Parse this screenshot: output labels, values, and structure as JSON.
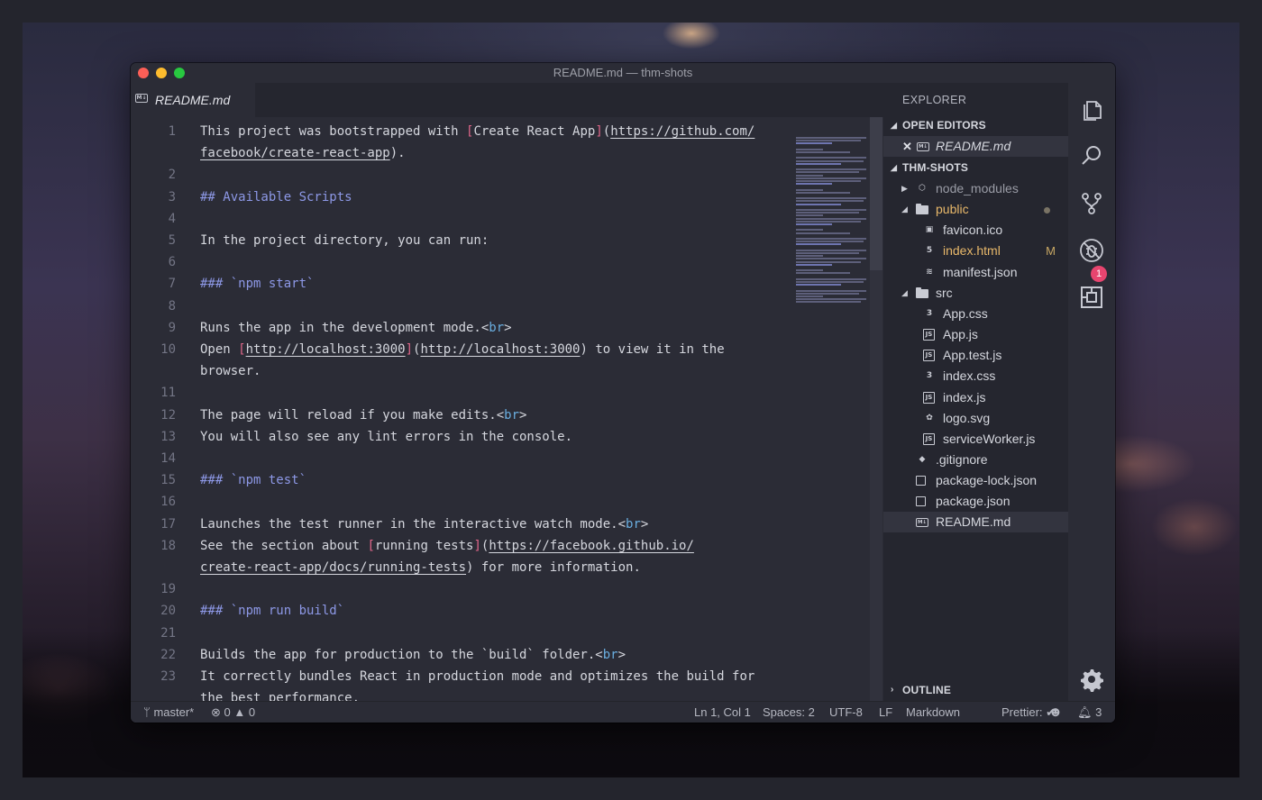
{
  "window": {
    "title": "README.md — thm-shots"
  },
  "editor": {
    "tab_label": "README.md",
    "lines": [
      {
        "n": "1",
        "segments": [
          {
            "t": "This project was bootstrapped with "
          },
          {
            "t": "[",
            "c": "brk"
          },
          {
            "t": "Create React App"
          },
          {
            "t": "]",
            "c": "brk"
          },
          {
            "t": "("
          },
          {
            "t": "https://github.com/",
            "c": "url"
          }
        ]
      },
      {
        "n": "",
        "segments": [
          {
            "t": "facebook/create-react-app",
            "c": "url"
          },
          {
            "t": ")."
          }
        ]
      },
      {
        "n": "2",
        "segments": []
      },
      {
        "n": "3",
        "segments": [
          {
            "t": "## Available Scripts",
            "c": "head"
          }
        ]
      },
      {
        "n": "4",
        "segments": []
      },
      {
        "n": "5",
        "segments": [
          {
            "t": "In the project directory, you can run:"
          }
        ]
      },
      {
        "n": "6",
        "segments": []
      },
      {
        "n": "7",
        "segments": [
          {
            "t": "### `npm start`",
            "c": "head"
          }
        ]
      },
      {
        "n": "8",
        "segments": []
      },
      {
        "n": "9",
        "segments": [
          {
            "t": "Runs the app in the development mode.<"
          },
          {
            "t": "br",
            "c": "tagc"
          },
          {
            "t": ">"
          }
        ]
      },
      {
        "n": "10",
        "segments": [
          {
            "t": "Open "
          },
          {
            "t": "[",
            "c": "brk"
          },
          {
            "t": "http://localhost:3000",
            "c": "url"
          },
          {
            "t": "]",
            "c": "brk"
          },
          {
            "t": "("
          },
          {
            "t": "http://localhost:3000",
            "c": "url"
          },
          {
            "t": ") to view it in the"
          }
        ]
      },
      {
        "n": "",
        "segments": [
          {
            "t": "browser."
          }
        ]
      },
      {
        "n": "11",
        "segments": []
      },
      {
        "n": "12",
        "segments": [
          {
            "t": "The page will reload if you make edits.<"
          },
          {
            "t": "br",
            "c": "tagc"
          },
          {
            "t": ">"
          }
        ]
      },
      {
        "n": "13",
        "segments": [
          {
            "t": "You will also see any lint errors in the console."
          }
        ]
      },
      {
        "n": "14",
        "segments": []
      },
      {
        "n": "15",
        "segments": [
          {
            "t": "### `npm test`",
            "c": "head"
          }
        ]
      },
      {
        "n": "16",
        "segments": []
      },
      {
        "n": "17",
        "segments": [
          {
            "t": "Launches the test runner in the interactive watch mode.<"
          },
          {
            "t": "br",
            "c": "tagc"
          },
          {
            "t": ">"
          }
        ]
      },
      {
        "n": "18",
        "segments": [
          {
            "t": "See the section about "
          },
          {
            "t": "[",
            "c": "brk"
          },
          {
            "t": "running tests"
          },
          {
            "t": "]",
            "c": "brk"
          },
          {
            "t": "("
          },
          {
            "t": "https://facebook.github.io/",
            "c": "url"
          }
        ]
      },
      {
        "n": "",
        "segments": [
          {
            "t": "create-react-app/docs/running-tests",
            "c": "url"
          },
          {
            "t": ") for more information."
          }
        ]
      },
      {
        "n": "19",
        "segments": []
      },
      {
        "n": "20",
        "segments": [
          {
            "t": "### `npm run build`",
            "c": "head"
          }
        ]
      },
      {
        "n": "21",
        "segments": []
      },
      {
        "n": "22",
        "segments": [
          {
            "t": "Builds the app for production to the `build` folder.<"
          },
          {
            "t": "br",
            "c": "tagc"
          },
          {
            "t": ">"
          }
        ]
      },
      {
        "n": "23",
        "segments": [
          {
            "t": "It correctly bundles React in production mode and optimizes the build for"
          }
        ]
      },
      {
        "n": "",
        "segments": [
          {
            "t": "the best performance."
          }
        ]
      }
    ]
  },
  "explorer": {
    "title": "EXPLORER",
    "open_editors_label": "OPEN EDITORS",
    "open_editor_file": "README.md",
    "project_label": "THM-SHOTS",
    "outline_label": "OUTLINE",
    "tree": [
      {
        "name": "node_modules",
        "icon": "node-icon",
        "depth": 1,
        "caret": "right",
        "dim": true
      },
      {
        "name": "public",
        "icon": "folder-icon",
        "depth": 1,
        "caret": "down",
        "status": "modified-dot",
        "modified": true
      },
      {
        "name": "favicon.ico",
        "icon": "image-file-icon",
        "depth": 2
      },
      {
        "name": "index.html",
        "icon": "html-file-icon",
        "depth": 2,
        "modified": true,
        "badge": "M"
      },
      {
        "name": "manifest.json",
        "icon": "database-icon",
        "depth": 2
      },
      {
        "name": "src",
        "icon": "folder-icon",
        "depth": 1,
        "caret": "down"
      },
      {
        "name": "App.css",
        "icon": "css-file-icon",
        "depth": 2
      },
      {
        "name": "App.js",
        "icon": "js-file-icon",
        "depth": 2
      },
      {
        "name": "App.test.js",
        "icon": "js-file-icon",
        "depth": 2
      },
      {
        "name": "index.css",
        "icon": "css-file-icon",
        "depth": 2
      },
      {
        "name": "index.js",
        "icon": "js-file-icon",
        "depth": 2
      },
      {
        "name": "logo.svg",
        "icon": "svg-file-icon",
        "depth": 2
      },
      {
        "name": "serviceWorker.js",
        "icon": "js-file-icon",
        "depth": 2
      },
      {
        "name": ".gitignore",
        "icon": "git-icon",
        "depth": 1
      },
      {
        "name": "package-lock.json",
        "icon": "package-icon",
        "depth": 1
      },
      {
        "name": "package.json",
        "icon": "package-icon",
        "depth": 1
      },
      {
        "name": "README.md",
        "icon": "markdown-file-icon",
        "depth": 1,
        "active": true
      }
    ]
  },
  "activity_bar": {
    "scm_badge": "1"
  },
  "status_bar": {
    "branch": "master*",
    "errors": "0",
    "warnings": "0",
    "position": "Ln 1, Col 1",
    "spaces": "Spaces: 2",
    "encoding": "UTF-8",
    "eol": "LF",
    "language": "Markdown",
    "formatter": "Prettier: ✔",
    "notifications": "3"
  },
  "colors": {
    "background": "#2b2c36",
    "sidebar": "#25262f",
    "heading": "#8d98e6",
    "tag": "#6aaee0",
    "bracket": "#e0668a",
    "modified": "#e8b86a",
    "badge": "#e8456f"
  }
}
